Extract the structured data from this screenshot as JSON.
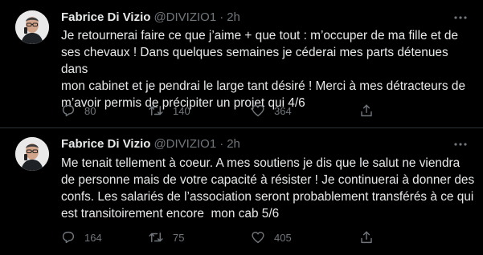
{
  "tweets": [
    {
      "author": {
        "name": "Fabrice Di Vizio",
        "handle": "@DIVIZIO1",
        "separator": "·",
        "time": "2h"
      },
      "text": "Je retournerai faire ce que j’aime + que tout : m’occuper de ma fille et de\nses chevaux ! Dans quelques semaines je céderai mes parts détenues dans\nmon cabinet et je pendrai le large tant désiré ! Merci à mes détracteurs de\nm’avoir permis de précipiter un projet qui 4/6",
      "counts": {
        "replies": "80",
        "retweets": "140",
        "likes": "364"
      }
    },
    {
      "author": {
        "name": "Fabrice Di Vizio",
        "handle": "@DIVIZIO1",
        "separator": "·",
        "time": "2h"
      },
      "text": "Me tenait tellement à coeur. A mes soutiens je dis que le salut ne viendra\nde personne mais de votre capacité à résister ! Je continuerai à donner des\nconfs. Les salariés de l’association seront probablement transférés à ce qui\nest transitoirement encore  mon cab 5/6",
      "counts": {
        "replies": "164",
        "retweets": "75",
        "likes": "405"
      }
    }
  ],
  "icons": {
    "more": "more-icon",
    "reply": "reply-icon",
    "retweet": "retweet-icon",
    "like": "like-icon",
    "share": "share-icon"
  },
  "colors": {
    "background": "#000000",
    "text": "#e7e9ea",
    "secondary": "#71767b",
    "divider": "#2f3336"
  }
}
